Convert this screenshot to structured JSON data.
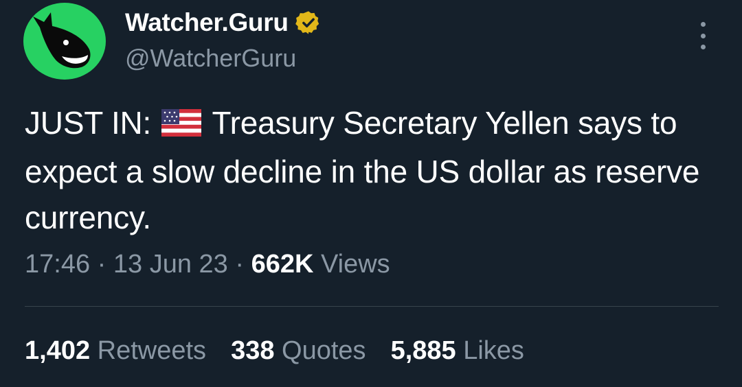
{
  "author": {
    "display_name": "Watcher.Guru",
    "handle": "@WatcherGuru",
    "avatar_icon": "whale-icon",
    "avatar_color": "#27d162",
    "verified_icon": "verified-badge-icon",
    "verified_color": "#e2b719"
  },
  "tweet": {
    "text_prefix": "JUST IN:",
    "flag_icon": "us-flag-icon",
    "text_body": "Treasury Secretary Yellen says to expect a slow decline in the US dollar as reserve currency."
  },
  "meta": {
    "time": "17:46",
    "separator": "·",
    "date": "13 Jun 23",
    "views_count": "662K",
    "views_label": "Views"
  },
  "stats": [
    {
      "count": "1,402",
      "label": "Retweets"
    },
    {
      "count": "338",
      "label": "Quotes"
    },
    {
      "count": "5,885",
      "label": "Likes"
    }
  ],
  "colors": {
    "background": "#15202b",
    "secondary_text": "#8b98a5",
    "divider": "#38444d"
  }
}
